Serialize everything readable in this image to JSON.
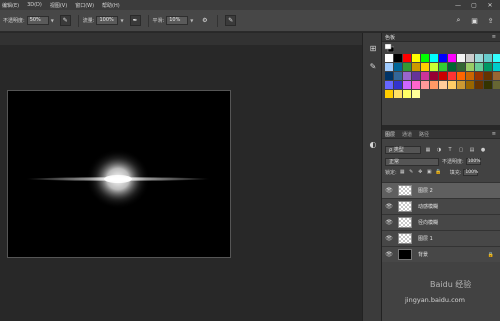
{
  "menu": {
    "items": [
      "编辑(E)",
      "3D(D)",
      "视图(V)",
      "窗口(W)",
      "帮助(H)"
    ],
    "win_min": "—",
    "win_max": "▢",
    "win_close": "✕"
  },
  "options": {
    "opacity_label": "不透明度:",
    "opacity_value": "50%",
    "flow_label": "流量:",
    "flow_value": "100%",
    "smooth_label": "平滑:",
    "smooth_value": "10%"
  },
  "swatches": {
    "tab_label": "色板",
    "rows": [
      [
        "#ffffff",
        "#000000",
        "#ff0000",
        "#ffff00",
        "#00ff00",
        "#00ffff",
        "#0000ff",
        "#ff00ff",
        "#f3f3f3",
        "#cccccc",
        "#9bd8d8",
        "#66cccc",
        "#33ffff",
        "#2080ff",
        "#0033cc"
      ],
      [
        "#a0ccff",
        "#006699",
        "#339933",
        "#cc9900",
        "#ffcc00",
        "#ccff33",
        "#33cc33",
        "#006633",
        "#336633",
        "#99cc66",
        "#66cc99",
        "#009966",
        "#00cccc",
        "#0099cc"
      ],
      [
        "#003366",
        "#336699",
        "#9966cc",
        "#663399",
        "#cc3399",
        "#990033",
        "#cc0000",
        "#ff3333",
        "#ff6600",
        "#cc6600",
        "#993300",
        "#663300",
        "#996633",
        "#cc9966"
      ],
      [
        "#6666ff",
        "#3333cc",
        "#cc66ff",
        "#ff66cc",
        "#ff9999",
        "#ff9966",
        "#ffcc99",
        "#ffcc66",
        "#cc9933",
        "#996600",
        "#663300",
        "#333300",
        "#666633",
        "#999966"
      ],
      [
        "#ffcc00",
        "#ffe066",
        "#ffff66",
        "#ffff99"
      ]
    ]
  },
  "layers_panel": {
    "tabs": [
      "图层",
      "通道",
      "路径"
    ],
    "kind": "ρ 类型",
    "blend_mode": "正常",
    "opacity_label": "不透明度:",
    "opacity_value": "100%",
    "lock_label": "锁定:",
    "fill_label": "填充:",
    "fill_value": "100%",
    "layers": [
      {
        "name": "图层 2",
        "thumb": "transparent",
        "selected": true
      },
      {
        "name": "动感模糊",
        "thumb": "transparent",
        "selected": false
      },
      {
        "name": "径向模糊",
        "thumb": "transparent",
        "selected": false
      },
      {
        "name": "图层 1",
        "thumb": "transparent",
        "selected": false
      },
      {
        "name": "背景",
        "thumb": "black",
        "selected": false,
        "locked": true
      }
    ]
  },
  "watermark": {
    "text": "jingyan.baidu.com",
    "logo": "Baidu 经验"
  }
}
